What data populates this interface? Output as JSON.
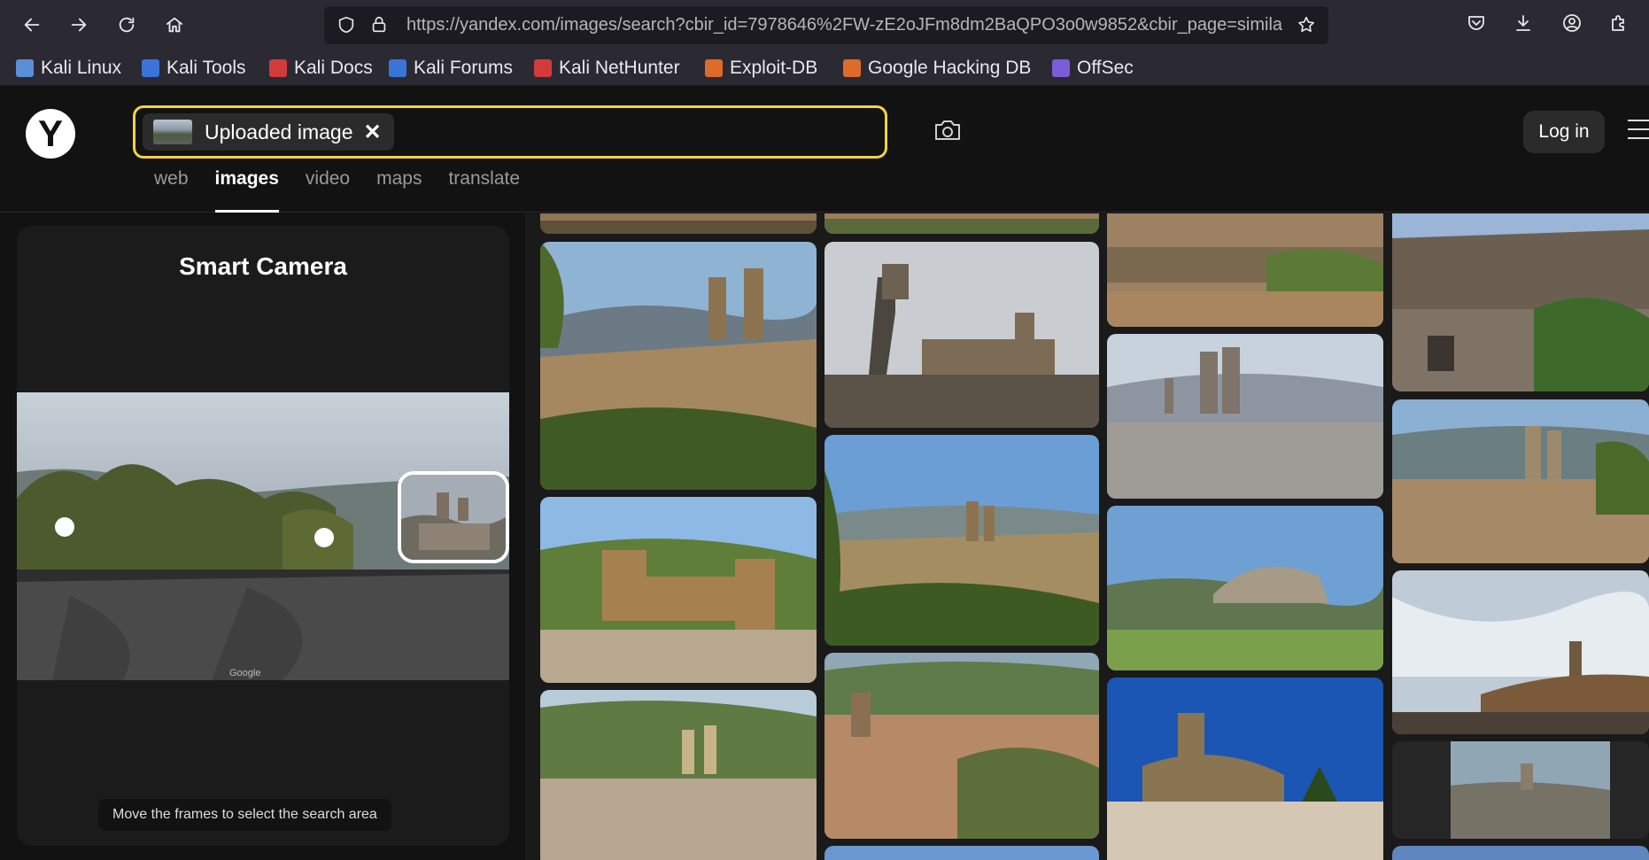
{
  "browser": {
    "url": "https://yandex.com/images/search?cbir_id=7978646%2FW-zE2oJFm8dm2BaQPO3o0w9852&cbir_page=similar"
  },
  "bookmarks": [
    {
      "label": "Kali Linux",
      "color": "#5a8fd8"
    },
    {
      "label": "Kali Tools",
      "color": "#3b74d8"
    },
    {
      "label": "Kali Docs",
      "color": "#d13b3b"
    },
    {
      "label": "Kali Forums",
      "color": "#3b74d8"
    },
    {
      "label": "Kali NetHunter",
      "color": "#d13b3b"
    },
    {
      "label": "Exploit-DB",
      "color": "#e06a2a"
    },
    {
      "label": "Google Hacking DB",
      "color": "#e06a2a"
    },
    {
      "label": "OffSec",
      "color": "#7a5cd8"
    }
  ],
  "header": {
    "logo": "Y",
    "search_chip_label": "Uploaded image",
    "search_chip_close": "✕",
    "login_label": "Log in",
    "accent_color": "#f5d33c"
  },
  "tabs": [
    {
      "label": "web",
      "active": false
    },
    {
      "label": "images",
      "active": true
    },
    {
      "label": "video",
      "active": false
    },
    {
      "label": "maps",
      "active": false
    },
    {
      "label": "translate",
      "active": false
    }
  ],
  "smart_camera": {
    "title": "Smart Camera",
    "hint": "Move the frames to select the search area",
    "watermark": "Google"
  }
}
